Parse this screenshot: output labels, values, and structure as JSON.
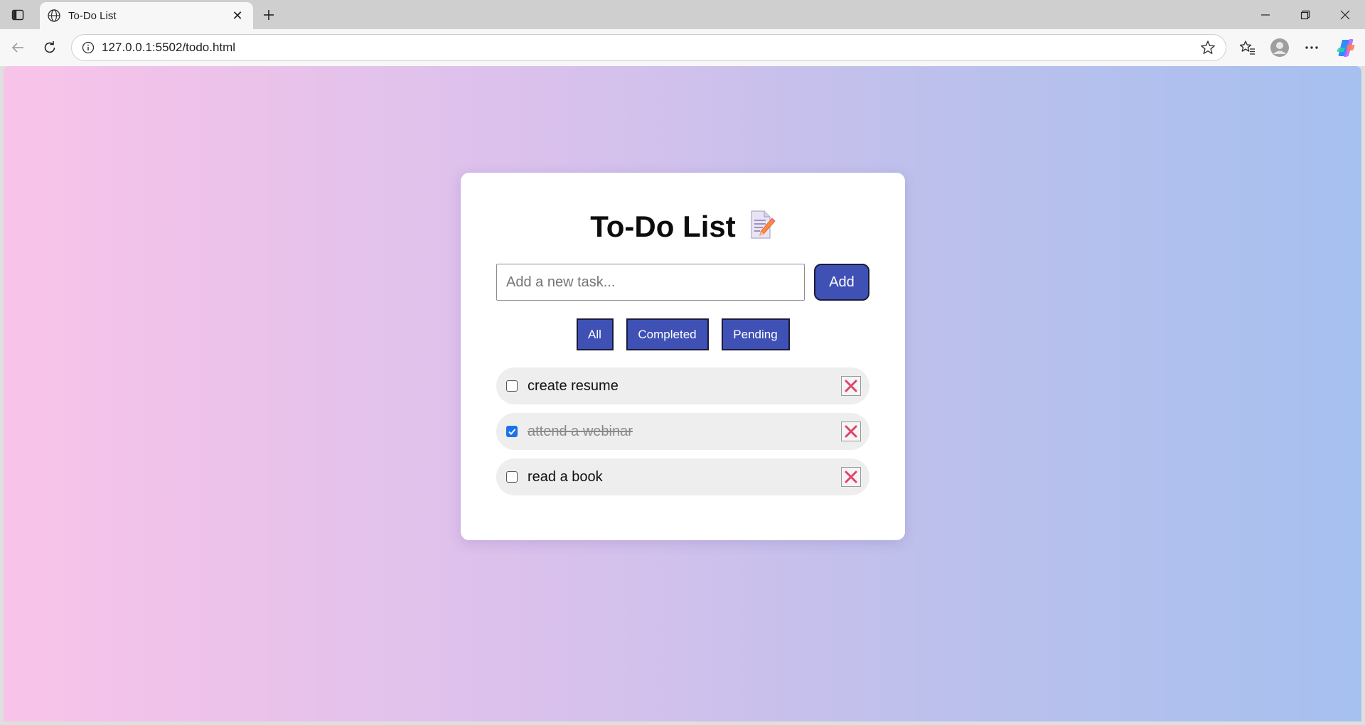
{
  "browser": {
    "tab_title": "To-Do List",
    "url": "127.0.0.1:5502/todo.html",
    "icons": {
      "sidebar": "sidebar-toggle-icon",
      "tab": "globe-icon",
      "back": "back-arrow-icon",
      "reload": "reload-icon",
      "info": "info-icon",
      "favorite": "star-icon",
      "favorites": "favorites-icon",
      "profile": "profile-icon",
      "more": "more-icon",
      "copilot": "copilot-icon"
    }
  },
  "app": {
    "title": "To-Do List",
    "title_icon": "memo-icon",
    "input": {
      "placeholder": "Add a new task...",
      "value": ""
    },
    "add_label": "Add",
    "filters": {
      "all": "All",
      "completed": "Completed",
      "pending": "Pending"
    },
    "tasks": [
      {
        "text": "create resume",
        "completed": false
      },
      {
        "text": "attend a webinar",
        "completed": true
      },
      {
        "text": "read a book",
        "completed": false
      }
    ],
    "colors": {
      "accent": "#3f51b5",
      "delete": "#e0436a",
      "gradient_start": "#f9c3e9",
      "gradient_end": "#a6c0ef"
    }
  }
}
